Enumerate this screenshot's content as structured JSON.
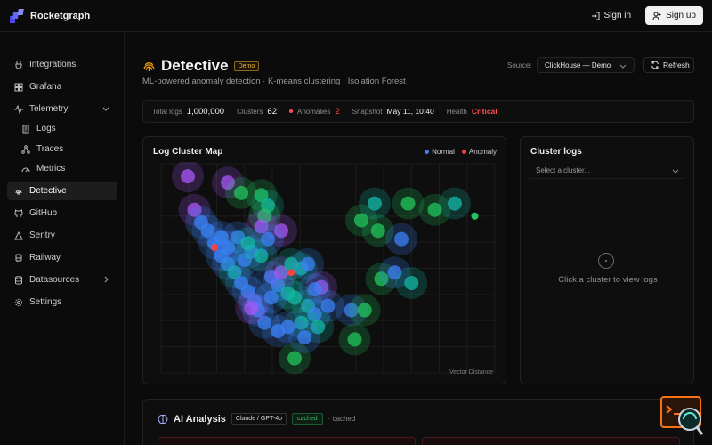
{
  "brand": {
    "name": "Rocketgraph"
  },
  "top_actions": {
    "sign_in": "Sign in",
    "sign_up": "Sign up"
  },
  "sidebar": {
    "items": [
      {
        "label": "Integrations",
        "icon": "plug-icon"
      },
      {
        "label": "Grafana",
        "icon": "dashboard-icon"
      },
      {
        "label": "Telemetry",
        "icon": "activity-icon",
        "expanded": true
      },
      {
        "label": "Logs",
        "icon": "scroll-icon",
        "sub": true
      },
      {
        "label": "Traces",
        "icon": "network-icon",
        "sub": true
      },
      {
        "label": "Metrics",
        "icon": "gauge-icon",
        "sub": true
      },
      {
        "label": "Detective",
        "icon": "fingerprint-icon",
        "active": true
      },
      {
        "label": "GitHub",
        "icon": "github-icon"
      },
      {
        "label": "Sentry",
        "icon": "sentry-icon"
      },
      {
        "label": "Railway",
        "icon": "railway-icon"
      },
      {
        "label": "Datasources",
        "icon": "database-icon"
      },
      {
        "label": "Settings",
        "icon": "gear-icon"
      }
    ]
  },
  "header": {
    "title": "Detective",
    "badge": "Demo",
    "subtitle": "ML-powered anomaly detection · K-means clustering · Isolation Forest",
    "source_label": "Source:",
    "source_value": "ClickHouse — Demo",
    "refresh_label": "Refresh"
  },
  "stats": {
    "total_logs_label": "Total logs",
    "total_logs": "1,000,000",
    "clusters_label": "Clusters",
    "clusters": "62",
    "anomalies_label": "Anomalies",
    "anomalies": "2",
    "snapshot_label": "Snapshot",
    "snapshot": "May 11, 10:40",
    "health_label": "Health",
    "health": "Critical"
  },
  "map": {
    "title": "Log Cluster Map",
    "legend_normal": "Normal",
    "legend_anomaly": "Anomaly",
    "axis_label": "Vector Distance",
    "colors": {
      "normal": "#3b82f6",
      "anomaly": "#ef4444"
    }
  },
  "chart_data": {
    "type": "scatter",
    "title": "Log Cluster Map",
    "xlabel": "Vector Distance",
    "series": [
      {
        "name": "Normal",
        "points": [
          [
            8,
            6,
            "#a855f7"
          ],
          [
            20,
            9,
            "#a855f7"
          ],
          [
            24,
            14,
            "#22c55e"
          ],
          [
            30,
            15,
            "#22c55e"
          ],
          [
            32,
            20,
            "#14b8a6"
          ],
          [
            31,
            25,
            "#22c55e"
          ],
          [
            30,
            30,
            "#a855f7"
          ],
          [
            36,
            32,
            "#a855f7"
          ],
          [
            60,
            27,
            "#22c55e"
          ],
          [
            65,
            32,
            "#22c55e"
          ],
          [
            64,
            19,
            "#14b8a6"
          ],
          [
            74,
            19,
            "#22c55e"
          ],
          [
            82,
            22,
            "#22c55e"
          ],
          [
            88,
            19,
            "#14b8a6"
          ],
          [
            72,
            36,
            "#3b82f6"
          ],
          [
            10,
            22,
            "#a855f7"
          ],
          [
            12,
            28,
            "#3b82f6"
          ],
          [
            14,
            32,
            "#3b82f6"
          ],
          [
            16,
            38,
            "#3b82f6"
          ],
          [
            18,
            44,
            "#3b82f6"
          ],
          [
            20,
            48,
            "#3b82f6"
          ],
          [
            22,
            52,
            "#14b8a6"
          ],
          [
            24,
            57,
            "#3b82f6"
          ],
          [
            26,
            61,
            "#3b82f6"
          ],
          [
            28,
            66,
            "#3b82f6"
          ],
          [
            29,
            70,
            "#3b82f6"
          ],
          [
            25,
            46,
            "#3b82f6"
          ],
          [
            27,
            42,
            "#3b82f6"
          ],
          [
            30,
            44,
            "#14b8a6"
          ],
          [
            33,
            54,
            "#3b82f6"
          ],
          [
            35,
            58,
            "#3b82f6"
          ],
          [
            36,
            52,
            "#a855f7"
          ],
          [
            39,
            48,
            "#14b8a6"
          ],
          [
            42,
            50,
            "#14b8a6"
          ],
          [
            44,
            48,
            "#3b82f6"
          ],
          [
            48,
            59,
            "#a855f7"
          ],
          [
            66,
            55,
            "#22c55e"
          ],
          [
            70,
            52,
            "#3b82f6"
          ],
          [
            75,
            57,
            "#14b8a6"
          ],
          [
            40,
            64,
            "#14b8a6"
          ],
          [
            44,
            68,
            "#14b8a6"
          ],
          [
            46,
            72,
            "#3b82f6"
          ],
          [
            50,
            68,
            "#3b82f6"
          ],
          [
            42,
            76,
            "#14b8a6"
          ],
          [
            38,
            78,
            "#3b82f6"
          ],
          [
            35,
            80,
            "#3b82f6"
          ],
          [
            57,
            70,
            "#3b82f6"
          ],
          [
            61,
            70,
            "#22c55e"
          ],
          [
            58,
            84,
            "#22c55e"
          ],
          [
            40,
            93,
            "#22c55e"
          ],
          [
            31,
            76,
            "#3b82f6"
          ],
          [
            27,
            69,
            "#a855f7"
          ],
          [
            20,
            40,
            "#3b82f6"
          ],
          [
            18,
            35,
            "#3b82f6"
          ],
          [
            32,
            36,
            "#3b82f6"
          ],
          [
            38,
            62,
            "#14b8a6"
          ],
          [
            46,
            60,
            "#3b82f6"
          ],
          [
            47,
            78,
            "#14b8a6"
          ],
          [
            43,
            83,
            "#3b82f6"
          ],
          [
            33,
            64,
            "#3b82f6"
          ],
          [
            23,
            35,
            "#3b82f6"
          ],
          [
            26,
            38,
            "#14b8a6"
          ]
        ]
      },
      {
        "name": "Anomaly",
        "points": [
          [
            16,
            40,
            "#ef4444"
          ],
          [
            39,
            52,
            "#ef4444"
          ],
          [
            94,
            25,
            "#22c55e"
          ]
        ]
      }
    ]
  },
  "logs": {
    "title": "Cluster logs",
    "select_placeholder": "Select a cluster...",
    "empty_text": "Click a cluster to view logs"
  },
  "ai": {
    "title": "AI Analysis",
    "model": "Claude / GPT-4o",
    "cached_badge": "cached",
    "cached_text": "· cached"
  }
}
